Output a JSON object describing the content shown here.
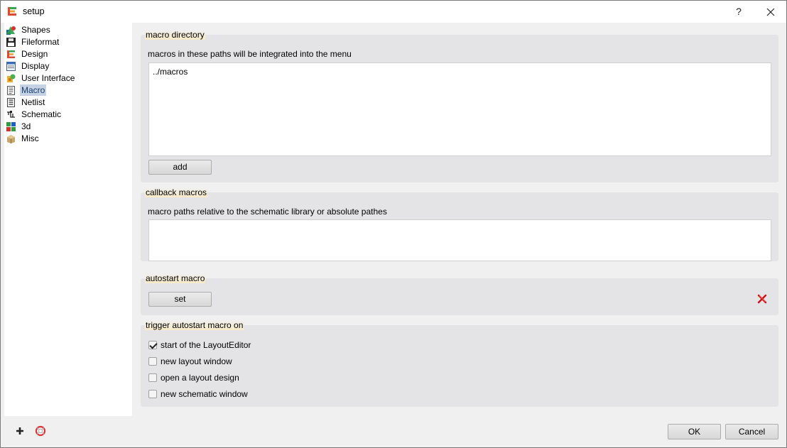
{
  "window": {
    "title": "setup",
    "help_label": "?",
    "close_icon": "close-icon",
    "app_icon": "layout-editor-icon"
  },
  "nav": {
    "items": [
      {
        "label": "Shapes",
        "icon": "shapes-icon"
      },
      {
        "label": "Fileformat",
        "icon": "floppy-icon"
      },
      {
        "label": "Design",
        "icon": "design-icon"
      },
      {
        "label": "Display",
        "icon": "display-icon"
      },
      {
        "label": "User Interface",
        "icon": "user-interface-icon"
      },
      {
        "label": "Macro",
        "icon": "macro-icon",
        "selected": true
      },
      {
        "label": "Netlist",
        "icon": "netlist-icon"
      },
      {
        "label": "Schematic",
        "icon": "schematic-icon"
      },
      {
        "label": "3d",
        "icon": "3d-icon"
      },
      {
        "label": "Misc",
        "icon": "misc-icon"
      }
    ]
  },
  "macro_directory": {
    "title": "macro directory",
    "description": "macros in these paths will be integrated into the menu",
    "paths": "../macros",
    "add_label": "add"
  },
  "callback_macros": {
    "title": "callback macros",
    "description": "macro paths relative to the schematic library or absolute pathes",
    "paths": ""
  },
  "autostart_macro": {
    "title": "autostart macro",
    "set_label": "set",
    "clear_icon": "red-x-icon"
  },
  "trigger": {
    "title": "trigger autostart macro on",
    "options": [
      {
        "label": "start of the LayoutEditor",
        "checked": true
      },
      {
        "label": "new layout window",
        "checked": false
      },
      {
        "label": "open a layout design",
        "checked": false
      },
      {
        "label": "new schematic window",
        "checked": false
      }
    ]
  },
  "footer": {
    "ok_label": "OK",
    "cancel_label": "Cancel",
    "add_icon": "plus-icon",
    "help_icon": "lifebuoy-icon"
  },
  "colors": {
    "selected_bg": "#c5d2e3",
    "panel_bg": "#e4e4e7",
    "clear_red": "#cc1111"
  }
}
